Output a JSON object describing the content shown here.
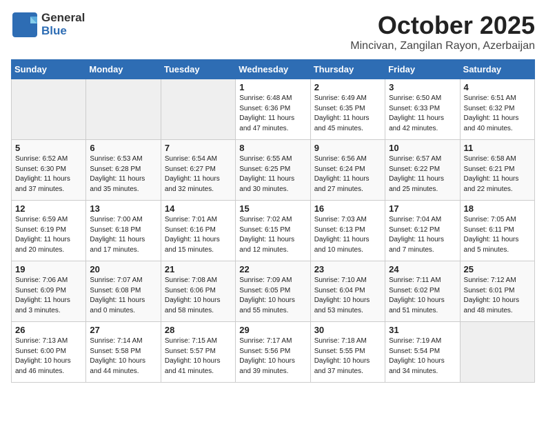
{
  "header": {
    "logo_general": "General",
    "logo_blue": "Blue",
    "month": "October 2025",
    "location": "Mincivan, Zangilan Rayon, Azerbaijan"
  },
  "weekdays": [
    "Sunday",
    "Monday",
    "Tuesday",
    "Wednesday",
    "Thursday",
    "Friday",
    "Saturday"
  ],
  "weeks": [
    [
      {
        "day": "",
        "empty": true
      },
      {
        "day": "",
        "empty": true
      },
      {
        "day": "",
        "empty": true
      },
      {
        "day": "1",
        "sunrise": "6:48 AM",
        "sunset": "6:36 PM",
        "daylight": "11 hours and 47 minutes."
      },
      {
        "day": "2",
        "sunrise": "6:49 AM",
        "sunset": "6:35 PM",
        "daylight": "11 hours and 45 minutes."
      },
      {
        "day": "3",
        "sunrise": "6:50 AM",
        "sunset": "6:33 PM",
        "daylight": "11 hours and 42 minutes."
      },
      {
        "day": "4",
        "sunrise": "6:51 AM",
        "sunset": "6:32 PM",
        "daylight": "11 hours and 40 minutes."
      }
    ],
    [
      {
        "day": "5",
        "sunrise": "6:52 AM",
        "sunset": "6:30 PM",
        "daylight": "11 hours and 37 minutes."
      },
      {
        "day": "6",
        "sunrise": "6:53 AM",
        "sunset": "6:28 PM",
        "daylight": "11 hours and 35 minutes."
      },
      {
        "day": "7",
        "sunrise": "6:54 AM",
        "sunset": "6:27 PM",
        "daylight": "11 hours and 32 minutes."
      },
      {
        "day": "8",
        "sunrise": "6:55 AM",
        "sunset": "6:25 PM",
        "daylight": "11 hours and 30 minutes."
      },
      {
        "day": "9",
        "sunrise": "6:56 AM",
        "sunset": "6:24 PM",
        "daylight": "11 hours and 27 minutes."
      },
      {
        "day": "10",
        "sunrise": "6:57 AM",
        "sunset": "6:22 PM",
        "daylight": "11 hours and 25 minutes."
      },
      {
        "day": "11",
        "sunrise": "6:58 AM",
        "sunset": "6:21 PM",
        "daylight": "11 hours and 22 minutes."
      }
    ],
    [
      {
        "day": "12",
        "sunrise": "6:59 AM",
        "sunset": "6:19 PM",
        "daylight": "11 hours and 20 minutes."
      },
      {
        "day": "13",
        "sunrise": "7:00 AM",
        "sunset": "6:18 PM",
        "daylight": "11 hours and 17 minutes."
      },
      {
        "day": "14",
        "sunrise": "7:01 AM",
        "sunset": "6:16 PM",
        "daylight": "11 hours and 15 minutes."
      },
      {
        "day": "15",
        "sunrise": "7:02 AM",
        "sunset": "6:15 PM",
        "daylight": "11 hours and 12 minutes."
      },
      {
        "day": "16",
        "sunrise": "7:03 AM",
        "sunset": "6:13 PM",
        "daylight": "11 hours and 10 minutes."
      },
      {
        "day": "17",
        "sunrise": "7:04 AM",
        "sunset": "6:12 PM",
        "daylight": "11 hours and 7 minutes."
      },
      {
        "day": "18",
        "sunrise": "7:05 AM",
        "sunset": "6:11 PM",
        "daylight": "11 hours and 5 minutes."
      }
    ],
    [
      {
        "day": "19",
        "sunrise": "7:06 AM",
        "sunset": "6:09 PM",
        "daylight": "11 hours and 3 minutes."
      },
      {
        "day": "20",
        "sunrise": "7:07 AM",
        "sunset": "6:08 PM",
        "daylight": "11 hours and 0 minutes."
      },
      {
        "day": "21",
        "sunrise": "7:08 AM",
        "sunset": "6:06 PM",
        "daylight": "10 hours and 58 minutes."
      },
      {
        "day": "22",
        "sunrise": "7:09 AM",
        "sunset": "6:05 PM",
        "daylight": "10 hours and 55 minutes."
      },
      {
        "day": "23",
        "sunrise": "7:10 AM",
        "sunset": "6:04 PM",
        "daylight": "10 hours and 53 minutes."
      },
      {
        "day": "24",
        "sunrise": "7:11 AM",
        "sunset": "6:02 PM",
        "daylight": "10 hours and 51 minutes."
      },
      {
        "day": "25",
        "sunrise": "7:12 AM",
        "sunset": "6:01 PM",
        "daylight": "10 hours and 48 minutes."
      }
    ],
    [
      {
        "day": "26",
        "sunrise": "7:13 AM",
        "sunset": "6:00 PM",
        "daylight": "10 hours and 46 minutes."
      },
      {
        "day": "27",
        "sunrise": "7:14 AM",
        "sunset": "5:58 PM",
        "daylight": "10 hours and 44 minutes."
      },
      {
        "day": "28",
        "sunrise": "7:15 AM",
        "sunset": "5:57 PM",
        "daylight": "10 hours and 41 minutes."
      },
      {
        "day": "29",
        "sunrise": "7:17 AM",
        "sunset": "5:56 PM",
        "daylight": "10 hours and 39 minutes."
      },
      {
        "day": "30",
        "sunrise": "7:18 AM",
        "sunset": "5:55 PM",
        "daylight": "10 hours and 37 minutes."
      },
      {
        "day": "31",
        "sunrise": "7:19 AM",
        "sunset": "5:54 PM",
        "daylight": "10 hours and 34 minutes."
      },
      {
        "day": "",
        "empty": true
      }
    ]
  ],
  "labels": {
    "sunrise": "Sunrise:",
    "sunset": "Sunset:",
    "daylight": "Daylight:"
  }
}
